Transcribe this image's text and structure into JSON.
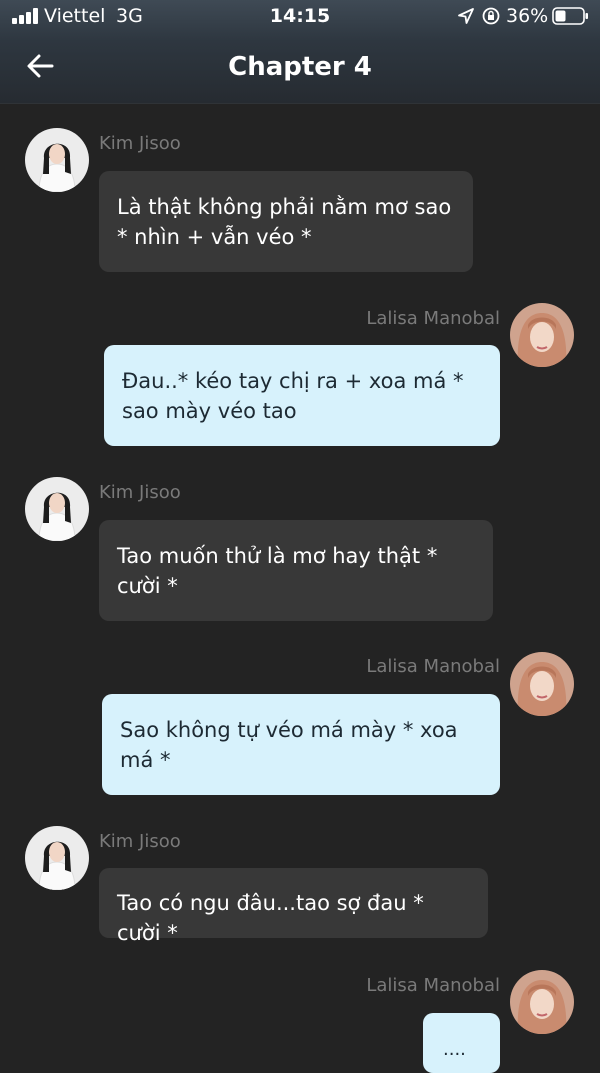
{
  "status_bar": {
    "carrier": "Viettel",
    "network": "3G",
    "time": "14:15",
    "battery": "36%"
  },
  "nav": {
    "title": "Chapter 4"
  },
  "colors": {
    "background": "#232323",
    "left_bubble": "#383838",
    "right_bubble": "#d7f2fc",
    "sender_name": "#7a7a7a"
  },
  "messages": [
    {
      "sender": "Kim Jisoo",
      "side": "left",
      "text": "Là thật không phải nằm mơ sao * nhìn + vẫn véo *"
    },
    {
      "sender": "Lalisa Manobal",
      "side": "right",
      "text": "Đau..* kéo tay chị ra + xoa má * sao mày véo tao"
    },
    {
      "sender": "Kim Jisoo",
      "side": "left",
      "text": "Tao muốn thử là mơ hay thật * cười *"
    },
    {
      "sender": "Lalisa Manobal",
      "side": "right",
      "text": "Sao không tự véo má mày * xoa má *"
    },
    {
      "sender": "Kim Jisoo",
      "side": "left",
      "text": "Tao có ngu đâu...tao sợ đau * cười *"
    },
    {
      "sender": "Lalisa Manobal",
      "side": "right",
      "text": "...."
    }
  ]
}
